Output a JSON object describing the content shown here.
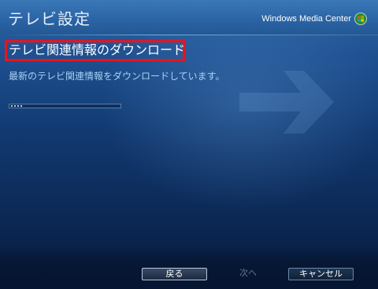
{
  "window": {
    "title": "テレビ設定",
    "brand": "Windows Media Center"
  },
  "page": {
    "heading": "テレビ関連情報のダウンロード",
    "status": "最新のテレビ関連情報をダウンロードしています。"
  },
  "progress": {
    "indeterminate": true,
    "dots": 4
  },
  "buttons": {
    "back": "戻る",
    "next": "次へ",
    "cancel": "キャンセル"
  },
  "colors": {
    "highlight_box": "#e8141c",
    "status_text": "#a9d2f2",
    "background": "#123a72"
  },
  "icons": {
    "logo": "windows-media-center-logo-icon",
    "watermark": "arrow-right-icon"
  }
}
